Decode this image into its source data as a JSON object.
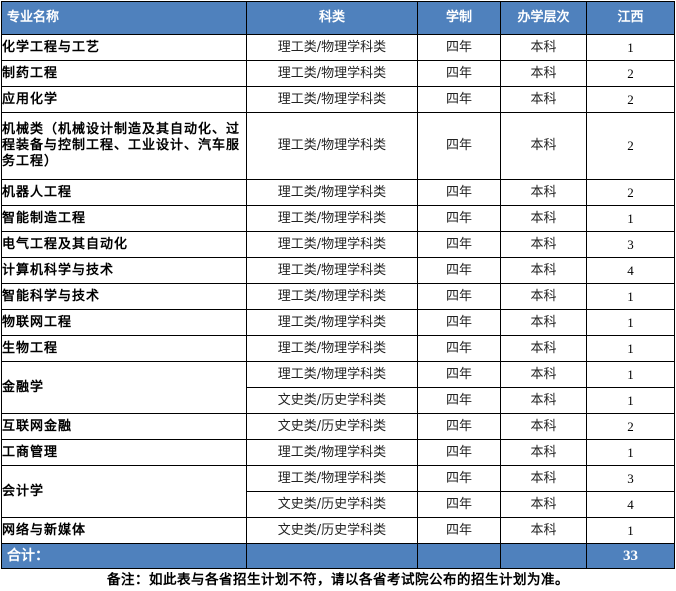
{
  "table": {
    "headers": {
      "name": "专业名称",
      "category": "科类",
      "duration": "学制",
      "level": "办学层次",
      "province": "江西"
    },
    "rows": [
      {
        "name": "化学工程与工艺",
        "entries": [
          {
            "category": "理工类/物理学科类",
            "duration": "四年",
            "level": "本科",
            "count": "1"
          }
        ]
      },
      {
        "name": "制药工程",
        "entries": [
          {
            "category": "理工类/物理学科类",
            "duration": "四年",
            "level": "本科",
            "count": "2"
          }
        ]
      },
      {
        "name": "应用化学",
        "entries": [
          {
            "category": "理工类/物理学科类",
            "duration": "四年",
            "level": "本科",
            "count": "2"
          }
        ]
      },
      {
        "name": "机械类（机械设计制造及其自动化、过程装备与控制工程、工业设计、汽车服务工程）",
        "entries": [
          {
            "category": "理工类/物理学科类",
            "duration": "四年",
            "level": "本科",
            "count": "2"
          }
        ]
      },
      {
        "name": "机器人工程",
        "entries": [
          {
            "category": "理工类/物理学科类",
            "duration": "四年",
            "level": "本科",
            "count": "2"
          }
        ]
      },
      {
        "name": "智能制造工程",
        "entries": [
          {
            "category": "理工类/物理学科类",
            "duration": "四年",
            "level": "本科",
            "count": "1"
          }
        ]
      },
      {
        "name": "电气工程及其自动化",
        "entries": [
          {
            "category": "理工类/物理学科类",
            "duration": "四年",
            "level": "本科",
            "count": "3"
          }
        ]
      },
      {
        "name": "计算机科学与技术",
        "entries": [
          {
            "category": "理工类/物理学科类",
            "duration": "四年",
            "level": "本科",
            "count": "4"
          }
        ]
      },
      {
        "name": "智能科学与技术",
        "entries": [
          {
            "category": "理工类/物理学科类",
            "duration": "四年",
            "level": "本科",
            "count": "1"
          }
        ]
      },
      {
        "name": "物联网工程",
        "entries": [
          {
            "category": "理工类/物理学科类",
            "duration": "四年",
            "level": "本科",
            "count": "1"
          }
        ]
      },
      {
        "name": "生物工程",
        "entries": [
          {
            "category": "理工类/物理学科类",
            "duration": "四年",
            "level": "本科",
            "count": "1"
          }
        ]
      },
      {
        "name": "金融学",
        "entries": [
          {
            "category": "理工类/物理学科类",
            "duration": "四年",
            "level": "本科",
            "count": "1"
          },
          {
            "category": "文史类/历史学科类",
            "duration": "四年",
            "level": "本科",
            "count": "1"
          }
        ]
      },
      {
        "name": "互联网金融",
        "entries": [
          {
            "category": "文史类/历史学科类",
            "duration": "四年",
            "level": "本科",
            "count": "2"
          }
        ]
      },
      {
        "name": "工商管理",
        "entries": [
          {
            "category": "理工类/物理学科类",
            "duration": "四年",
            "level": "本科",
            "count": "1"
          }
        ]
      },
      {
        "name": "会计学",
        "entries": [
          {
            "category": "理工类/物理学科类",
            "duration": "四年",
            "level": "本科",
            "count": "3"
          },
          {
            "category": "文史类/历史学科类",
            "duration": "四年",
            "level": "本科",
            "count": "4"
          }
        ]
      },
      {
        "name": "网络与新媒体",
        "entries": [
          {
            "category": "文史类/历史学科类",
            "duration": "四年",
            "level": "本科",
            "count": "1"
          }
        ]
      }
    ],
    "total": {
      "label": "合计：",
      "value": "33"
    },
    "note": "备注：如此表与各省招生计划不符，请以各省考试院公布的招生计划为准。"
  }
}
